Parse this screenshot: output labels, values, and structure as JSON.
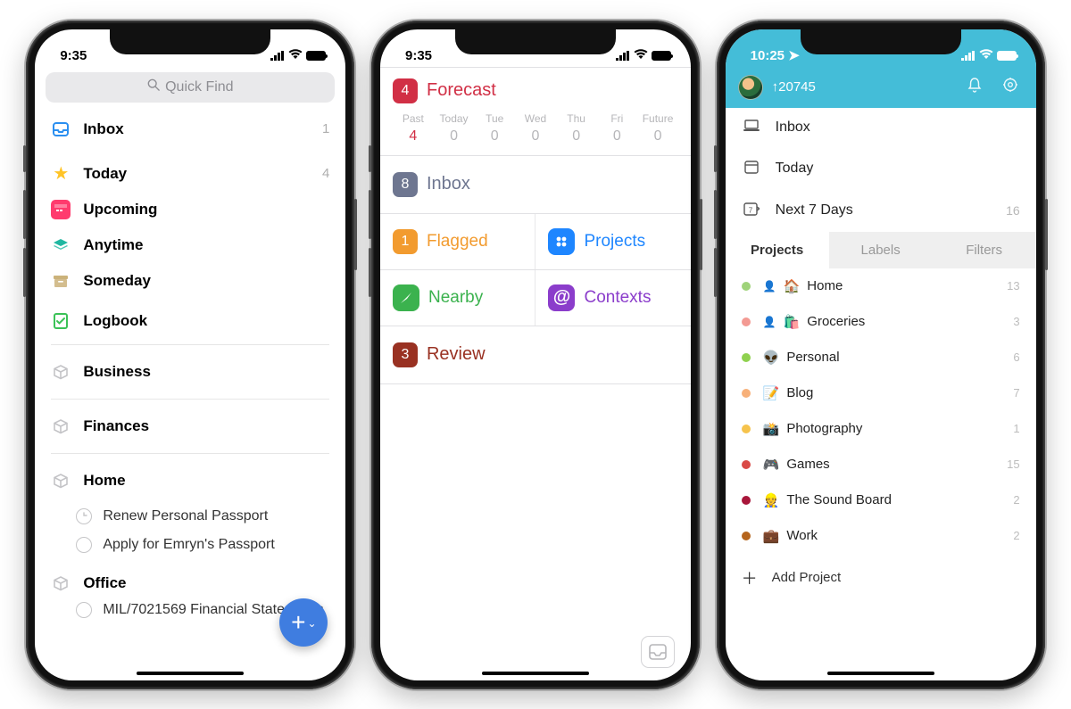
{
  "phone1": {
    "time": "9:35",
    "quick_find": "Quick Find",
    "lists": [
      {
        "label": "Inbox",
        "count": "1",
        "color": "#2b8ff0"
      },
      {
        "label": "Today",
        "count": "4",
        "color": "#ffc427"
      },
      {
        "label": "Upcoming",
        "count": "",
        "color": "#ff3b6e"
      },
      {
        "label": "Anytime",
        "count": "",
        "color": "#20b7a1"
      },
      {
        "label": "Someday",
        "count": "",
        "color": "#cbb27a"
      },
      {
        "label": "Logbook",
        "count": "",
        "color": "#3bc257"
      }
    ],
    "areas_top": [
      {
        "label": "Business"
      },
      {
        "label": "Finances"
      }
    ],
    "area_home": "Home",
    "home_tasks": [
      "Renew Personal Passport",
      "Apply for Emryn's Passport"
    ],
    "area_office": "Office",
    "office_task_cut": "MIL/7021569 Financial Statements"
  },
  "phone2": {
    "time": "9:35",
    "forecast": {
      "label": "Forecast",
      "badge": "4",
      "color": "#d12f45",
      "days": [
        {
          "h": "Past",
          "n": "4",
          "cls": "past"
        },
        {
          "h": "Today",
          "n": "0"
        },
        {
          "h": "Tue",
          "n": "0"
        },
        {
          "h": "Wed",
          "n": "0"
        },
        {
          "h": "Thu",
          "n": "0"
        },
        {
          "h": "Fri",
          "n": "0"
        },
        {
          "h": "Future",
          "n": "0"
        }
      ]
    },
    "inbox": {
      "label": "Inbox",
      "badge": "8",
      "badge_bg": "#6e7690",
      "color": "#6e7690"
    },
    "flagged": {
      "label": "Flagged",
      "badge": "1",
      "badge_bg": "#f29b2f",
      "color": "#f29b2f"
    },
    "projects": {
      "label": "Projects",
      "color": "#1e86ff",
      "ic_bg": "#1e86ff"
    },
    "nearby": {
      "label": "Nearby",
      "color": "#3bb24e",
      "ic_bg": "#3bb24e"
    },
    "contexts": {
      "label": "Contexts",
      "color": "#8b3dcb",
      "ic_bg": "#8b3dcb"
    },
    "review": {
      "label": "Review",
      "badge": "3",
      "badge_bg": "#993122",
      "color": "#993122"
    }
  },
  "phone3": {
    "time": "10:25",
    "karma": "20745",
    "main": [
      {
        "label": "Inbox",
        "icon": "laptop",
        "count": ""
      },
      {
        "label": "Today",
        "icon": "calendar-today",
        "count": ""
      },
      {
        "label": "Next 7 Days",
        "icon": "calendar-7",
        "count": "16"
      }
    ],
    "tabs": {
      "projects": "Projects",
      "labels": "Labels",
      "filters": "Filters"
    },
    "projects": [
      {
        "dot": "#9fd37a",
        "emoji": "🏠",
        "label": "Home",
        "count": "13",
        "shared": true
      },
      {
        "dot": "#f39a93",
        "emoji": "🛍️",
        "label": "Groceries",
        "count": "3",
        "shared": true
      },
      {
        "dot": "#8fd14f",
        "emoji": "👽",
        "label": "Personal",
        "count": "6"
      },
      {
        "dot": "#f7b079",
        "emoji": "📝",
        "label": "Blog",
        "count": "7"
      },
      {
        "dot": "#f6c34c",
        "emoji": "📸",
        "label": "Photography",
        "count": "1"
      },
      {
        "dot": "#d94a46",
        "emoji": "🎮",
        "label": "Games",
        "count": "15"
      },
      {
        "dot": "#a8163a",
        "emoji": "👷",
        "label": "The Sound Board",
        "count": "2"
      },
      {
        "dot": "#b5651d",
        "emoji": "💼",
        "label": "Work",
        "count": "2"
      }
    ],
    "add_project": "Add Project"
  }
}
